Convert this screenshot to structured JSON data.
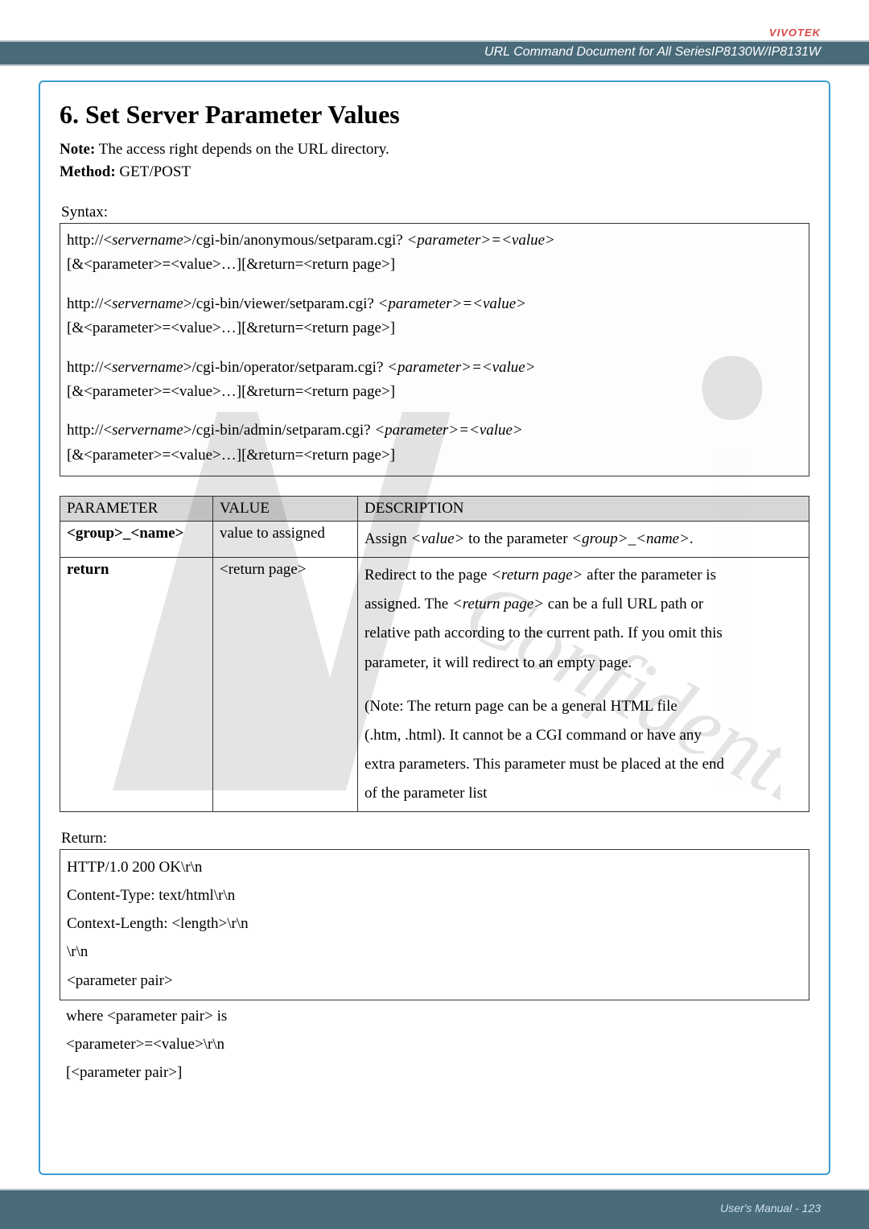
{
  "header": {
    "brand": "VIVOTEK",
    "subtitle": "URL Command Document for All SeriesIP8130W/IP8131W"
  },
  "section": {
    "title": "6. Set Server Parameter Values",
    "note_label": "Note:",
    "note_text": " The access right depends on the URL directory.",
    "method_label": "Method:",
    "method_text": " GET/POST"
  },
  "syntax": {
    "label": "Syntax:",
    "lines": [
      {
        "pre": "http://<",
        "srv": "servername",
        "mid": ">/cgi-bin/anonymous/setparam.cgi? ",
        "param": "<parameter>=<value>"
      },
      {
        "pre": "http://<",
        "srv": "servername",
        "mid": ">/cgi-bin/viewer/setparam.cgi? ",
        "param": "<parameter>=<value>"
      },
      {
        "pre": "http://<",
        "srv": "servername",
        "mid": ">/cgi-bin/operator/setparam.cgi? ",
        "param": "<parameter>=<value>"
      },
      {
        "pre": "http://<",
        "srv": "servername",
        "mid": ">/cgi-bin/admin/setparam.cgi? ",
        "param": "<parameter>=<value>"
      }
    ],
    "tail": "[&<parameter>=<value>…][&return=<return page>]"
  },
  "table": {
    "headers": {
      "p": "PARAMETER",
      "v": "VALUE",
      "d": "DESCRIPTION"
    },
    "rows": [
      {
        "param_html": "<group>_<name>",
        "value": "value to assigned",
        "desc_pre": "Assign ",
        "desc_i1": "<value>",
        "desc_mid1": " to the parameter ",
        "desc_i2": "<group>",
        "desc_mid2": "_",
        "desc_i3": "<name>",
        "desc_post": "."
      },
      {
        "param": "return",
        "value": "<return page>",
        "d1a": "Redirect to the page ",
        "d1i": "<return page>",
        "d1b": " after the parameter is",
        "d2a": "assigned. The ",
        "d2i": "<return page>",
        "d2b": " can be a full URL path or",
        "d3": "relative path according to the current path. If you omit this",
        "d4": "parameter, it will redirect to an empty page.",
        "d5": "(Note: The return page can be a general HTML file",
        "d6": "(.htm, .html). It cannot be a CGI command or have any",
        "d7": "extra parameters. This parameter must be placed at the end",
        "d8": "of the parameter list"
      }
    ]
  },
  "return": {
    "label": "Return:",
    "lines": [
      "HTTP/1.0 200 OK\\r\\n",
      "Content-Type: text/html\\r\\n",
      "Context-Length: <length>\\r\\n",
      "\\r\\n",
      "<parameter pair>"
    ],
    "after": [
      "where <parameter pair> is",
      "<parameter>=<value>\\r\\n",
      "[<parameter pair>]"
    ]
  },
  "footer": {
    "text": "User's Manual - 123"
  }
}
